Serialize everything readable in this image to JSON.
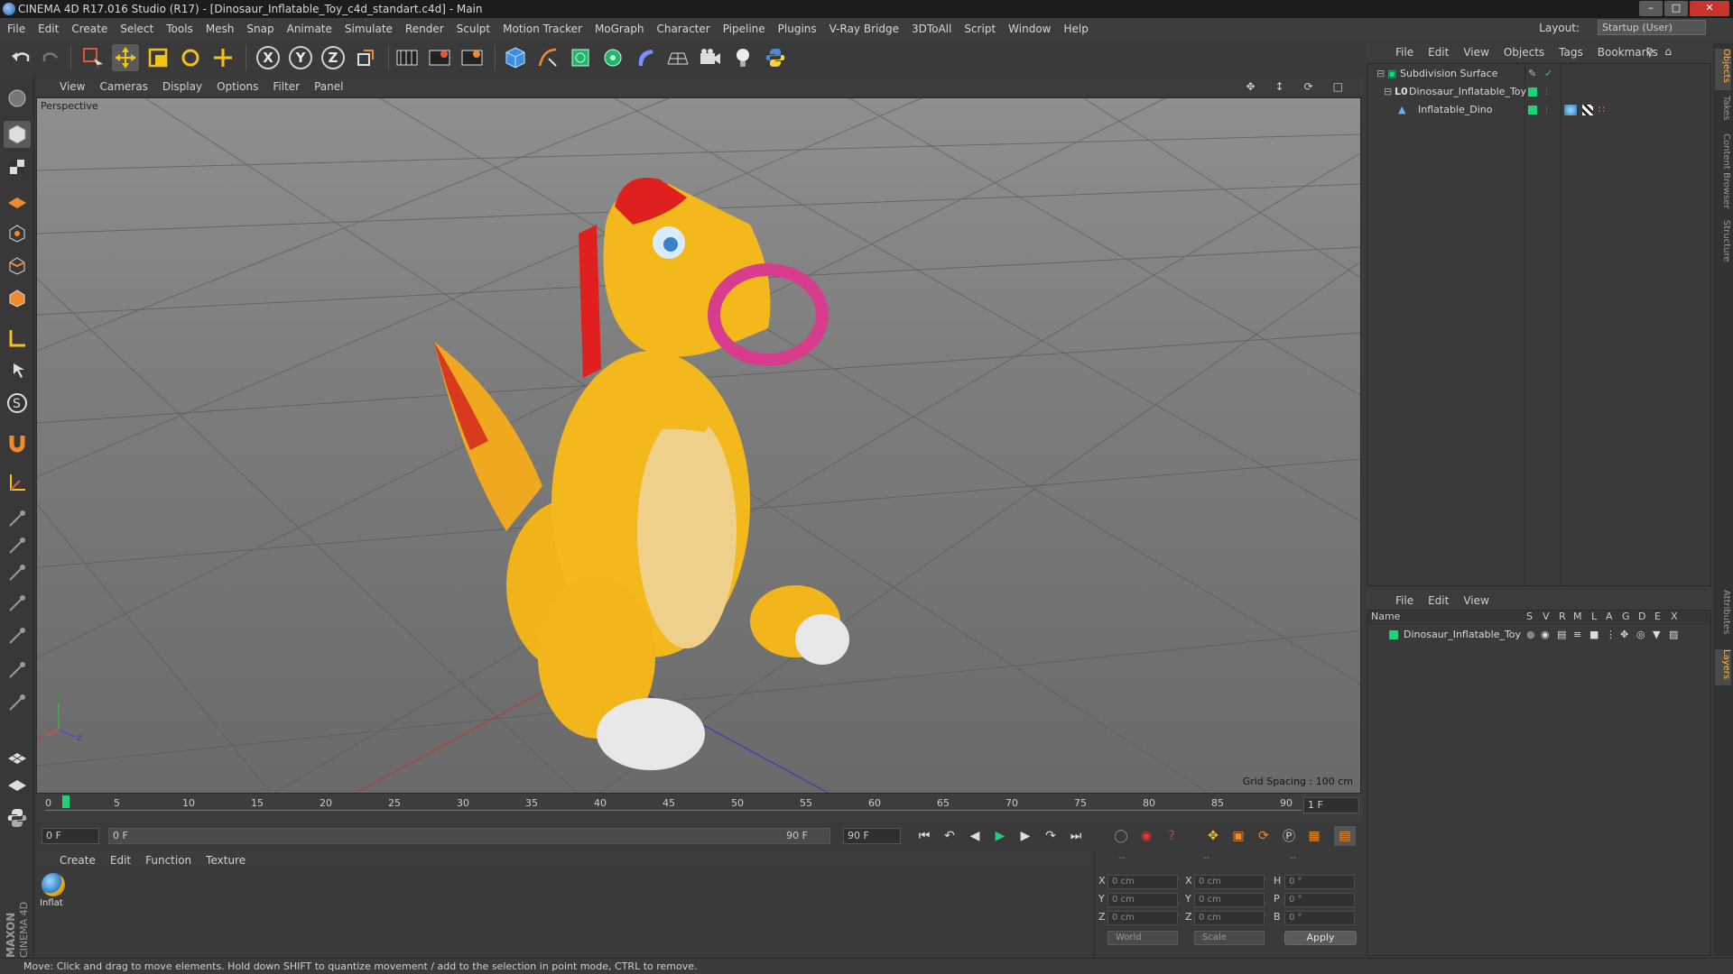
{
  "window": {
    "title": "CINEMA 4D R17.016 Studio (R17) - [Dinosaur_Inflatable_Toy_c4d_standart.c4d] - Main"
  },
  "menubar": [
    "File",
    "Edit",
    "Create",
    "Select",
    "Tools",
    "Mesh",
    "Snap",
    "Animate",
    "Simulate",
    "Render",
    "Sculpt",
    "Motion Tracker",
    "MoGraph",
    "Character",
    "Pipeline",
    "Plugins",
    "V-Ray Bridge",
    "3DToAll",
    "Script",
    "Window",
    "Help"
  ],
  "layout": {
    "label": "Layout:",
    "value": "Startup (User)"
  },
  "viewport": {
    "menu": [
      "View",
      "Cameras",
      "Display",
      "Options",
      "Filter",
      "Panel"
    ],
    "label": "Perspective",
    "grid_spacing": "Grid Spacing : 100 cm"
  },
  "timeline": {
    "ticks": [
      "0",
      "5",
      "10",
      "15",
      "20",
      "25",
      "30",
      "35",
      "40",
      "45",
      "50",
      "55",
      "60",
      "65",
      "70",
      "75",
      "80",
      "85",
      "90"
    ],
    "frame_end_label": "1 F",
    "current_frame": "0 F",
    "range_start": "0 F",
    "range_end": "90 F",
    "max_frame": "90 F"
  },
  "material_manager": {
    "menu": [
      "Create",
      "Edit",
      "Function",
      "Texture"
    ],
    "material_name": "Inflat"
  },
  "coordinates": {
    "header": [
      "--",
      "--",
      "--"
    ],
    "rows": [
      {
        "a": "X",
        "av": "0 cm",
        "b": "X",
        "bv": "0 cm",
        "c": "H",
        "cv": "0 °"
      },
      {
        "a": "Y",
        "av": "0 cm",
        "b": "Y",
        "bv": "0 cm",
        "c": "P",
        "cv": "0 °"
      },
      {
        "a": "Z",
        "av": "0 cm",
        "b": "Z",
        "bv": "0 cm",
        "c": "B",
        "cv": "0 °"
      }
    ],
    "mode": "World",
    "scale": "Scale",
    "apply": "Apply"
  },
  "status": "Move: Click and drag to move elements. Hold down SHIFT to quantize movement / add to the selection in point mode, CTRL to remove.",
  "object_manager": {
    "menu": [
      "File",
      "Edit",
      "View",
      "Objects",
      "Tags",
      "Bookmarks"
    ],
    "objects": [
      {
        "name": "Subdivision Surface"
      },
      {
        "name": "Dinosaur_Inflatable_Toy"
      },
      {
        "name": "Inflatable_Dino"
      }
    ]
  },
  "layer_manager": {
    "menu": [
      "File",
      "Edit",
      "View"
    ],
    "columns": [
      "Name",
      "S",
      "V",
      "R",
      "M",
      "L",
      "A",
      "G",
      "D",
      "E",
      "X"
    ],
    "layers": [
      {
        "name": "Dinosaur_Inflatable_Toy",
        "color": "#1ed27a"
      }
    ]
  },
  "side_tabs": [
    "Objects",
    "Takes",
    "Content Browser",
    "Structure",
    "Attributes",
    "Layers"
  ],
  "colors": {
    "accent_green": "#1ed27a",
    "close_red": "#c8352b",
    "toy_yellow": "#f0b41a",
    "ring_pink": "#d83c8c"
  }
}
